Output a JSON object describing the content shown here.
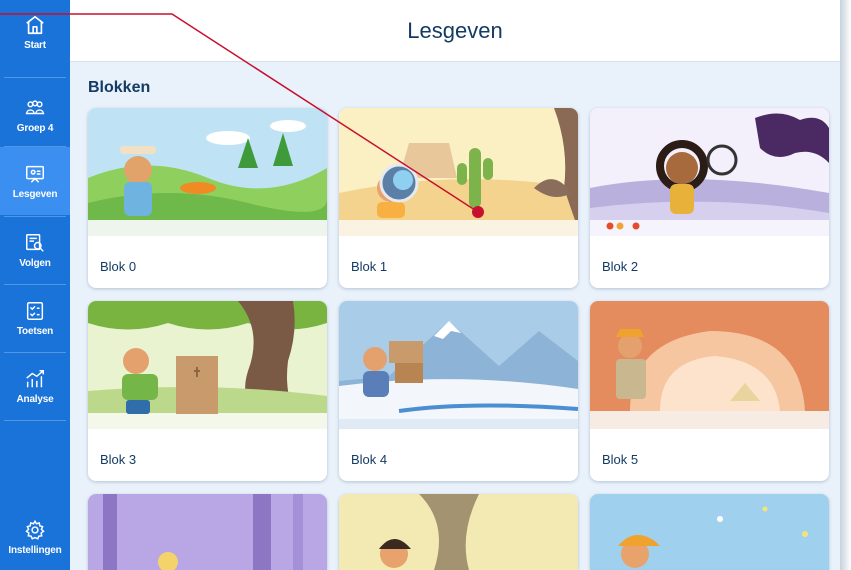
{
  "sidebar": {
    "items": [
      {
        "label": "Start",
        "icon": "home-icon"
      },
      {
        "label": "Groep 4",
        "icon": "group-icon"
      },
      {
        "label": "Lesgeven",
        "icon": "teach-board-icon",
        "active": true
      },
      {
        "label": "Volgen",
        "icon": "follow-search-icon"
      },
      {
        "label": "Toetsen",
        "icon": "test-checklist-icon"
      },
      {
        "label": "Analyse",
        "icon": "analysis-chart-icon"
      }
    ],
    "settings": {
      "label": "Instellingen",
      "icon": "gear-icon"
    }
  },
  "header": {
    "title": "Lesgeven"
  },
  "main": {
    "section_title": "Blokken",
    "blocks": [
      {
        "label": "Blok 0"
      },
      {
        "label": "Blok 1"
      },
      {
        "label": "Blok 2"
      },
      {
        "label": "Blok 3"
      },
      {
        "label": "Blok 4"
      },
      {
        "label": "Blok 5"
      }
    ]
  },
  "colors": {
    "sidebar": "#1a73d9",
    "sidebar_active": "#3a8ff0",
    "main_bg": "#e9f1fa",
    "heading_text": "#143b63",
    "annotation": "#c8102e"
  }
}
